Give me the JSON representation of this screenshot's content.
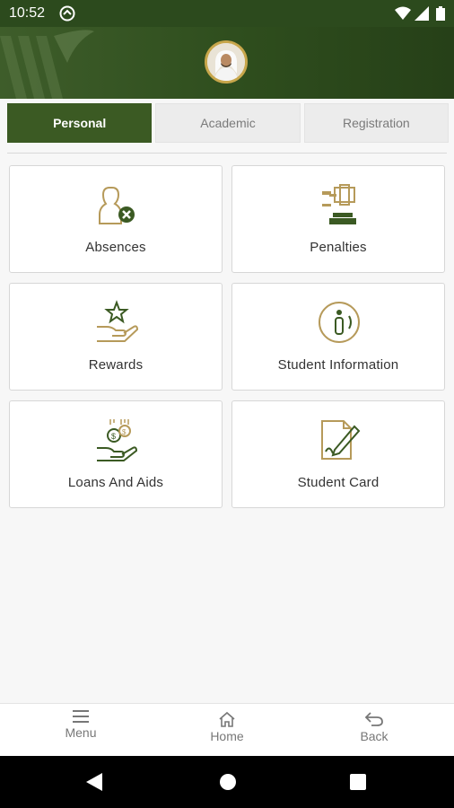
{
  "status_bar": {
    "time": "10:52"
  },
  "tabs": [
    {
      "label": "Personal",
      "active": true
    },
    {
      "label": "Academic",
      "active": false
    },
    {
      "label": "Registration",
      "active": false
    }
  ],
  "cards": [
    {
      "label": "Absences",
      "icon": "absences-icon"
    },
    {
      "label": "Penalties",
      "icon": "gavel-icon"
    },
    {
      "label": "Rewards",
      "icon": "reward-hand-star-icon"
    },
    {
      "label": "Student Information",
      "icon": "info-icon"
    },
    {
      "label": "Loans And Aids",
      "icon": "money-hand-icon"
    },
    {
      "label": "Student Card",
      "icon": "document-pen-icon"
    }
  ],
  "bottom_nav": {
    "menu": "Menu",
    "home": "Home",
    "back": "Back"
  },
  "colors": {
    "brand_green": "#3b5a23",
    "accent_gold": "#b69a5a",
    "status_bar": "#2c4a1d"
  }
}
